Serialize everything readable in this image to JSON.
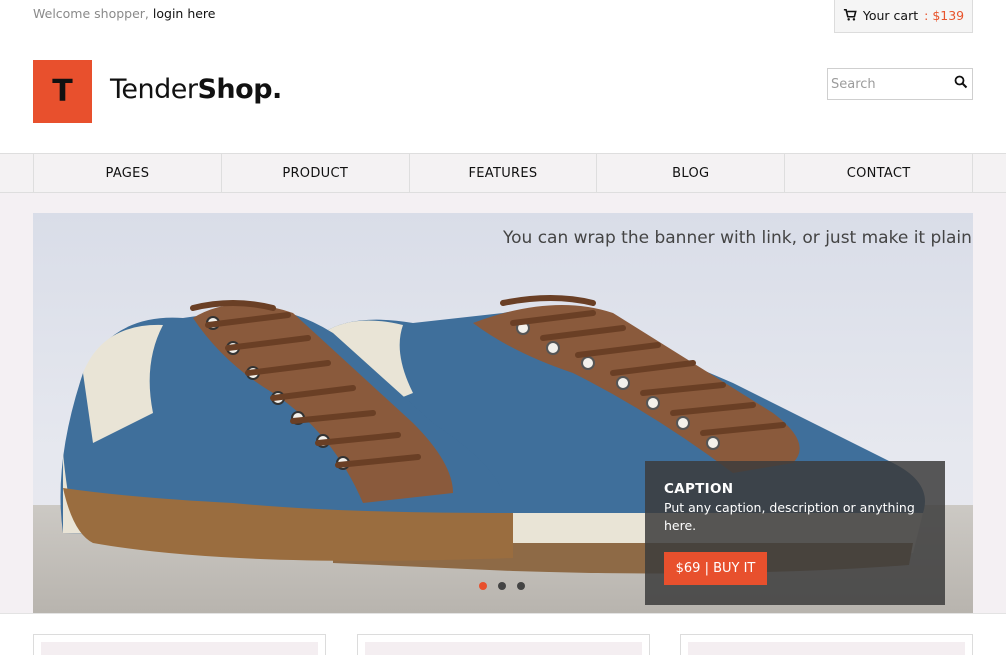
{
  "topbar": {
    "welcome_text": "Welcome shopper,",
    "login_label": "login here",
    "cart_label": "Your cart",
    "cart_separator": ":",
    "cart_amount": "$139"
  },
  "logo": {
    "mark": "T",
    "brand_regular": "Tender",
    "brand_bold": "Shop."
  },
  "search": {
    "placeholder": "Search",
    "icon": "search-icon"
  },
  "nav": {
    "items": [
      {
        "label": "PAGES"
      },
      {
        "label": "PRODUCT"
      },
      {
        "label": "FEATURES"
      },
      {
        "label": "BLOG"
      },
      {
        "label": "CONTACT"
      }
    ]
  },
  "banner": {
    "headline": "You can wrap the banner with link, or just  make it plain",
    "caption_title": "CAPTION",
    "caption_desc": "Put any caption, description or anything here.",
    "buy_label": "$69 | BUY IT",
    "slides_count": 3,
    "active_slide": 1
  },
  "colors": {
    "accent": "#e8502d",
    "nav_bg": "#f4f2f3",
    "caption_bg": "#3c3c3c"
  }
}
